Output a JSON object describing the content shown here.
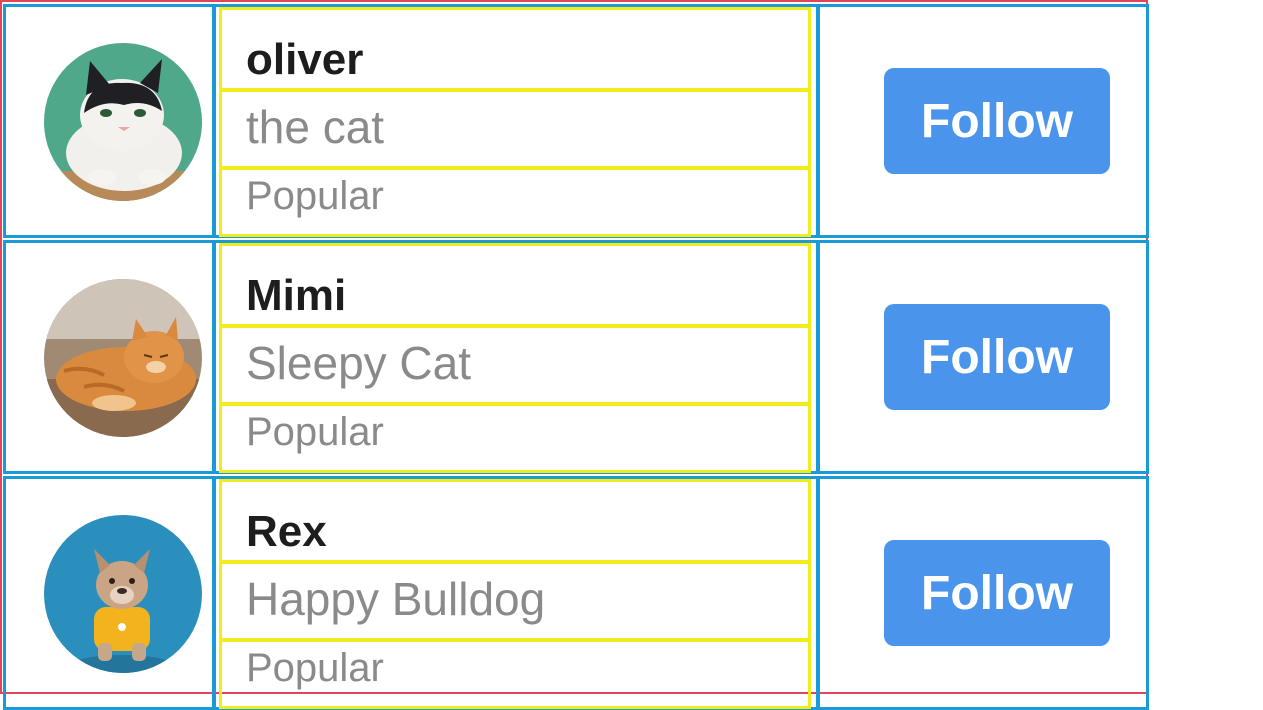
{
  "profiles": [
    {
      "name": "oliver",
      "subtitle": "the cat",
      "badge": "Popular",
      "follow_label": "Follow",
      "avatar_icon": "cat-avatar-icon"
    },
    {
      "name": "Mimi",
      "subtitle": "Sleepy Cat",
      "badge": "Popular",
      "follow_label": "Follow",
      "avatar_icon": "cat-avatar-icon"
    },
    {
      "name": "Rex",
      "subtitle": "Happy Bulldog",
      "badge": "Popular",
      "follow_label": "Follow",
      "avatar_icon": "dog-avatar-icon"
    }
  ],
  "colors": {
    "button": "#4a94ec",
    "row_border": "#1a9ad6",
    "text_border": "#f2ec1c",
    "outer_border": "#e0455a"
  }
}
